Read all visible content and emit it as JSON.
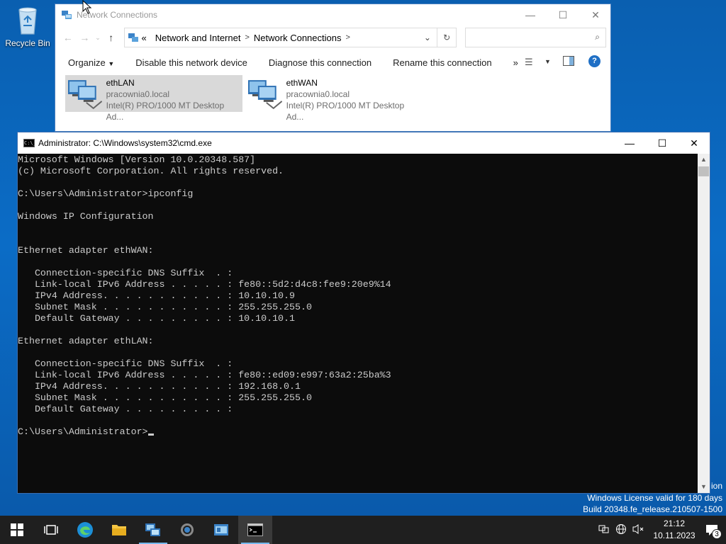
{
  "desktop": {
    "recycle_bin_label": "Recycle Bin"
  },
  "explorer": {
    "title": "Network Connections",
    "breadcrumb": {
      "overflow": "«",
      "items": [
        "Network and Internet",
        "Network Connections"
      ]
    },
    "search_placeholder": "",
    "commands": [
      "Organize",
      "Disable this network device",
      "Diagnose this connection",
      "Rename this connection"
    ],
    "overflow_chevron": "»",
    "connections": [
      {
        "name": "ethLAN",
        "domain": "pracownia0.local",
        "adapter": "Intel(R) PRO/1000 MT Desktop Ad...",
        "selected": true
      },
      {
        "name": "ethWAN",
        "domain": "pracownia0.local",
        "adapter": "Intel(R) PRO/1000 MT Desktop Ad...",
        "selected": false
      }
    ]
  },
  "cmd": {
    "title": "Administrator: C:\\Windows\\system32\\cmd.exe",
    "icon_text": "C:\\_",
    "output": "Microsoft Windows [Version 10.0.20348.587]\n(c) Microsoft Corporation. All rights reserved.\n\nC:\\Users\\Administrator>ipconfig\n\nWindows IP Configuration\n\n\nEthernet adapter ethWAN:\n\n   Connection-specific DNS Suffix  . :\n   Link-local IPv6 Address . . . . . : fe80::5d2:d4c8:fee9:20e9%14\n   IPv4 Address. . . . . . . . . . . : 10.10.10.9\n   Subnet Mask . . . . . . . . . . . : 255.255.255.0\n   Default Gateway . . . . . . . . . : 10.10.10.1\n\nEthernet adapter ethLAN:\n\n   Connection-specific DNS Suffix  . :\n   Link-local IPv6 Address . . . . . : fe80::ed09:e997:63a2:25ba%3\n   IPv4 Address. . . . . . . . . . . : 192.168.0.1\n   Subnet Mask . . . . . . . . . . . : 255.255.255.0\n   Default Gateway . . . . . . . . . :\n\nC:\\Users\\Administrator>"
  },
  "watermark": {
    "edition_fragment": "ion",
    "license": "Windows License valid for 180 days",
    "build": "Build 20348.fe_release.210507-1500"
  },
  "taskbar": {
    "clock_time": "21:12",
    "clock_date": "10.11.2023",
    "notification_count": "3",
    "colors": {
      "background": "#1f1f1f",
      "accent": "#76b9ed"
    }
  }
}
